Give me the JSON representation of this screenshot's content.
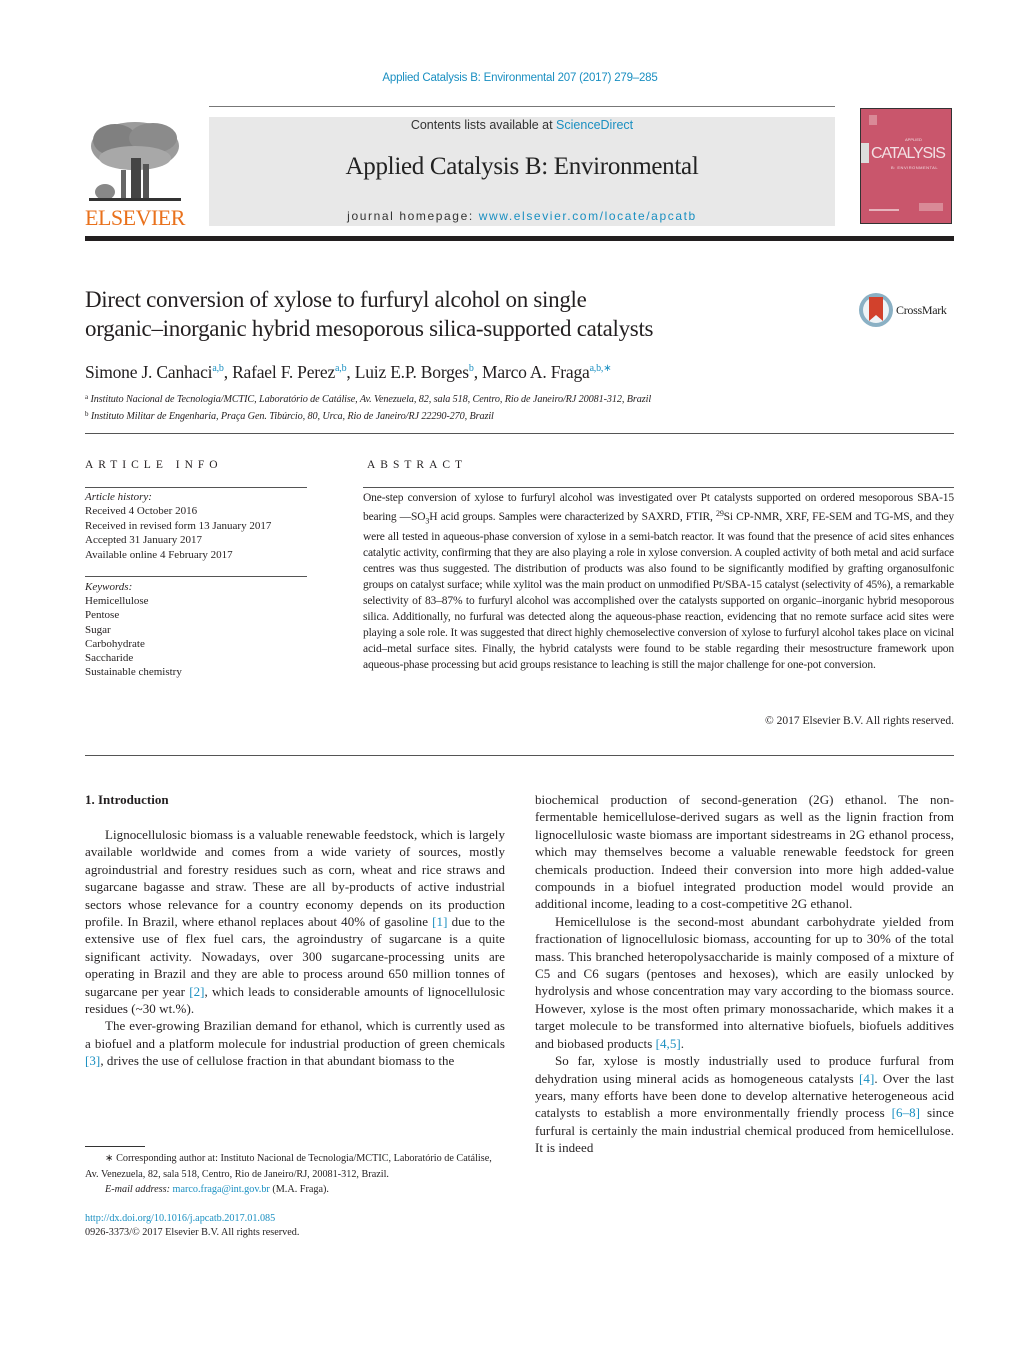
{
  "header": {
    "journal_reference": "Applied Catalysis B: Environmental 207 (2017) 279–285",
    "contents_prefix": "Contents lists available at ",
    "contents_link": "ScienceDirect",
    "journal_title": "Applied Catalysis B: Environmental",
    "homepage_prefix": "journal homepage: ",
    "homepage_link": "www.elsevier.com/locate/apcatb",
    "publisher_logo_text": "ELSEVIER",
    "cover_title": "CATALYSIS",
    "cover_small": "APPLIED",
    "cover_sub": "B: ENVIRONMENTAL",
    "colors": {
      "link": "#1a8fc1",
      "elsevier_orange": "#e9711c",
      "cover_pink": "#c9566c"
    }
  },
  "article": {
    "title_line1": "Direct conversion of xylose to furfuryl alcohol on single",
    "title_line2": "organic–inorganic hybrid mesoporous silica-supported catalysts",
    "crossmark_label": "CrossMark",
    "authors": [
      {
        "name": "Simone J. Canhaci",
        "affil": "a,b",
        "sep": ", "
      },
      {
        "name": "Rafael F. Perez",
        "affil": "a,b",
        "sep": ", "
      },
      {
        "name": "Luiz E.P. Borges",
        "affil": "b",
        "sep": ", "
      },
      {
        "name": "Marco A. Fraga",
        "affil": "a,b,∗",
        "sep": ""
      }
    ],
    "affiliations": [
      {
        "mark": "a",
        "text": "Instituto Nacional de Tecnologia/MCTIC, Laboratório de Catálise, Av. Venezuela, 82, sala 518, Centro, Rio de Janeiro/RJ 20081-312, Brazil"
      },
      {
        "mark": "b",
        "text": "Instituto Militar de Engenharia, Praça Gen. Tibúrcio, 80, Urca, Rio de Janeiro/RJ 22290-270, Brazil"
      }
    ]
  },
  "article_info": {
    "heading": "ARTICLE INFO",
    "history_label": "Article history:",
    "history": [
      "Received 4 October 2016",
      "Received in revised form 13 January 2017",
      "Accepted 31 January 2017",
      "Available online 4 February 2017"
    ],
    "keywords_label": "Keywords:",
    "keywords": [
      "Hemicellulose",
      "Pentose",
      "Sugar",
      "Carbohydrate",
      "Saccharide",
      "Sustainable chemistry"
    ]
  },
  "abstract": {
    "heading": "ABSTRACT",
    "part1": "One-step conversion of xylose to furfuryl alcohol was investigated over Pt catalysts supported on ordered mesoporous SBA-15 bearing —SO",
    "sub3": "3",
    "part2": "H acid groups. Samples were characterized by SAXRD, FTIR, ",
    "sup29": "29",
    "part3": "Si CP-NMR, XRF, FE-SEM and TG-MS, and they were all tested in aqueous-phase conversion of xylose in a semi-batch reactor. It was found that the presence of acid sites enhances catalytic activity, confirming that they are also playing a role in xylose conversion. A coupled activity of both metal and acid surface centres was thus suggested. The distribution of products was also found to be significantly modified by grafting organosulfonic groups on catalyst surface; while xylitol was the main product on unmodified Pt/SBA-15 catalyst (selectivity of 45%), a remarkable selectivity of 83–87% to furfuryl alcohol was accomplished over the catalysts supported on organic–inorganic hybrid mesoporous silica. Additionally, no furfural was detected along the aqueous-phase reaction, evidencing that no remote surface acid sites were playing a sole role. It was suggested that direct highly chemoselective conversion of xylose to furfuryl alcohol takes place on vicinal acid–metal surface sites. Finally, the hybrid catalysts were found to be stable regarding their mesostructure framework upon aqueous-phase processing but acid groups resistance to leaching is still the major challenge for one-pot conversion.",
    "copyright": "© 2017 Elsevier B.V. All rights reserved."
  },
  "body": {
    "section_heading": "1.  Introduction",
    "left_p1_a": "Lignocellulosic biomass is a valuable renewable feedstock, which is largely available worldwide and comes from a wide variety of sources, mostly agroindustrial and forestry residues such as corn, wheat and rice straws and sugarcane bagasse and straw. These are all by-products of active industrial sectors whose relevance for a country economy depends on its production profile. In Brazil, where ethanol replaces about 40% of gasoline ",
    "ref1": "[1]",
    "left_p1_b": " due to the extensive use of flex fuel cars, the agroindustry of sugarcane is a quite significant activity. Nowadays, over 300 sugarcane-processing units are operating in Brazil and they are able to process around 650 million tonnes of sugarcane per year ",
    "ref2": "[2]",
    "left_p1_c": ", which leads to considerable amounts of lignocellulosic residues (~30 wt.%).",
    "left_p2_a": "The ever-growing Brazilian demand for ethanol, which is currently used as a biofuel and a platform molecule for industrial production of green chemicals ",
    "ref3": "[3]",
    "left_p2_b": ", drives the use of cellulose fraction in that abundant biomass to the",
    "right_p1": "biochemical production of second-generation (2G) ethanol. The non-fermentable hemicellulose-derived sugars as well as the lignin fraction from lignocellulosic waste biomass are important sidestreams in 2G ethanol process, which may themselves become a valuable renewable feedstock for green chemicals production. Indeed their conversion into more high added-value compounds in a biofuel integrated production model would provide an additional income, leading to a cost-competitive 2G ethanol.",
    "right_p2_a": "Hemicellulose is the second-most abundant carbohydrate yielded from fractionation of lignocellulosic biomass, accounting for up to 30% of the total mass. This branched heteropolysaccharide is mainly composed of a mixture of C5 and C6 sugars (pentoses and hexoses), which are easily unlocked by hydrolysis and whose concentration may vary according to the biomass source. However, xylose is the most often primary monossacharide, which makes it a target molecule to be transformed into alternative biofuels, biofuels additives and biobased products ",
    "ref45": "[4,5]",
    "right_p2_b": ".",
    "right_p3_a": "So far, xylose is mostly industrially used to produce furfural from dehydration using mineral acids as homogeneous catalysts ",
    "ref4": "[4]",
    "right_p3_b": ". Over the last years, many efforts have been done to develop alternative heterogeneous acid catalysts to establish a more environmentally friendly process ",
    "ref68": "[6–8]",
    "right_p3_c": " since furfural is certainly the main industrial chemical produced from hemicellulose. It is indeed"
  },
  "footnote": {
    "star": "∗",
    "corresponding": " Corresponding author at: Instituto Nacional de Tecnologia/MCTIC, Laboratório de Catálise, Av. Venezuela, 82, sala 518, Centro, Rio de Janeiro/RJ, 20081-312, Brazil.",
    "email_label": "E-mail address: ",
    "email": "marco.fraga@int.gov.br",
    "email_suffix": " (M.A. Fraga).",
    "doi": "http://dx.doi.org/10.1016/j.apcatb.2017.01.085",
    "issn_line": "0926-3373/© 2017 Elsevier B.V. All rights reserved."
  }
}
